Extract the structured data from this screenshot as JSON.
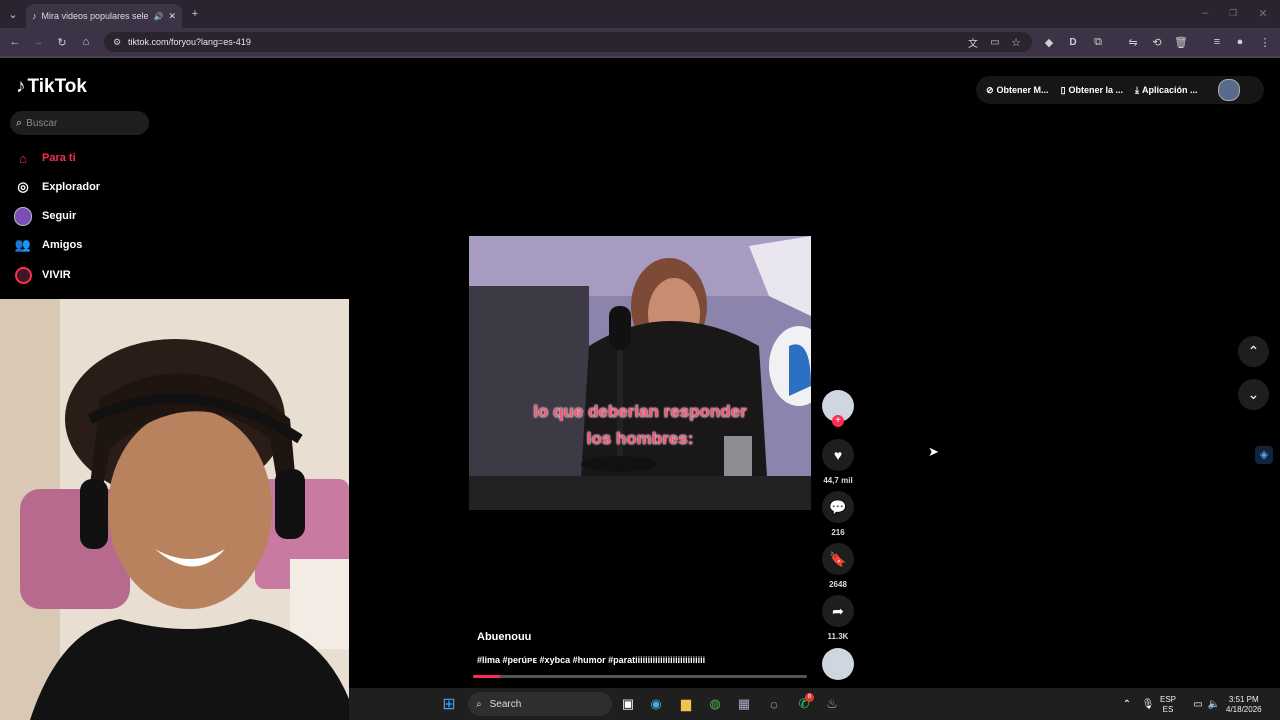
{
  "browser": {
    "tab_title": "Mira videos populares sele",
    "url": "tiktok.com/foryou?lang=es-419"
  },
  "tiktok": {
    "logo": "TikTok",
    "search_placeholder": "Buscar",
    "nav": [
      {
        "label": "Para ti",
        "icon": "home-icon",
        "active": true
      },
      {
        "label": "Explorador",
        "icon": "compass-icon"
      },
      {
        "label": "Seguir",
        "icon": "following-avatar-icon"
      },
      {
        "label": "Amigos",
        "icon": "friends-icon"
      },
      {
        "label": "VIVIR",
        "icon": "live-icon"
      }
    ],
    "top_buttons": [
      "Obtener M...",
      "Obtener la ...",
      "Aplicación ..."
    ],
    "video": {
      "caption_line1": "lo que deberian responder",
      "caption_line2": "los hombres:",
      "author": "Abuenouu",
      "hashtags": "#lima #perúᴘᴇ #xybca #humor #paratiiiiiiiiiiiiiiiiiiiiiiiiiiii",
      "likes": "44,7 mil",
      "comments": "216",
      "saves": "2648",
      "shares": "11.3K",
      "progress": 0.08
    }
  },
  "taskbar": {
    "search_label": "Search",
    "lang_line1": "ESP",
    "lang_line2": "ES",
    "time": "3:51 PM",
    "date": "4/18/2026",
    "whatsapp_badge": "8"
  },
  "colors": {
    "accent": "#fe2c55",
    "chrome_bg": "#3c3446"
  }
}
